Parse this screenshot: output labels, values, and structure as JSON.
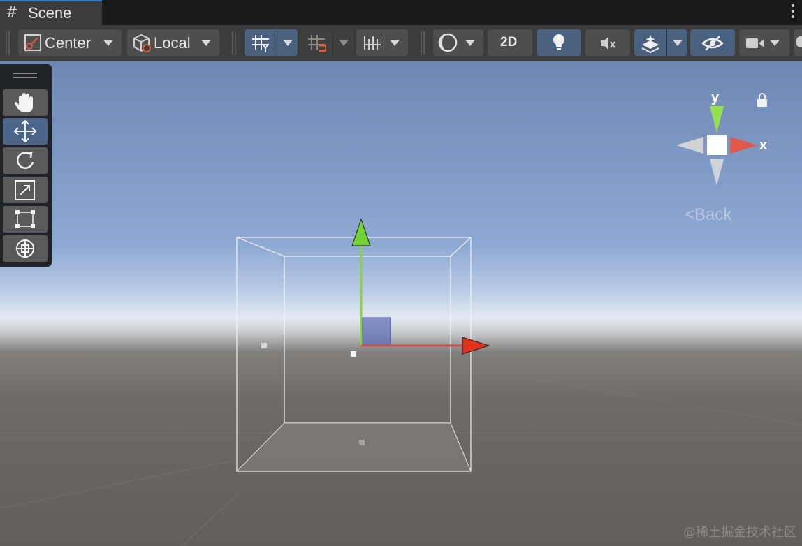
{
  "window": {
    "tab_title": "Scene",
    "tab_icon": "hash-icon"
  },
  "toolbar": {
    "pivot_mode_label": "Center",
    "pivot_rotation_label": "Local",
    "view_2d_label": "2D"
  },
  "tools": [
    "hand-tool",
    "move-tool",
    "rotate-tool",
    "scale-tool",
    "rect-tool",
    "transform-tool"
  ],
  "gizmo": {
    "y_label": "y",
    "x_label": "x",
    "back_label": "Back"
  },
  "watermark": "@稀土掘金技术社区",
  "colors": {
    "accent": "#4a607f",
    "x_axis": "#d9483b",
    "y_axis": "#8ed04a",
    "z_axis": "#4a5fbf"
  }
}
